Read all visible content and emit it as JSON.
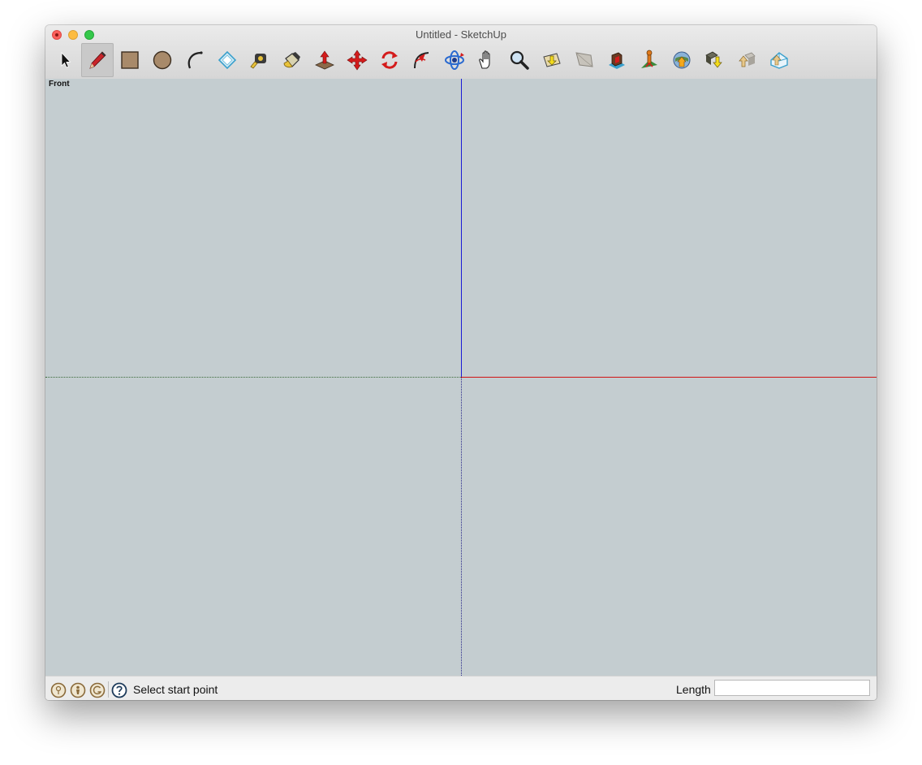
{
  "window": {
    "title": "Untitled - SketchUp",
    "controls": [
      "close",
      "minimize",
      "zoom"
    ]
  },
  "toolbar": {
    "active_tool": "line",
    "tools": [
      {
        "id": "select",
        "icon": "select-arrow-icon"
      },
      {
        "id": "line",
        "icon": "pencil-icon"
      },
      {
        "id": "rectangle",
        "icon": "rectangle-icon"
      },
      {
        "id": "circle",
        "icon": "circle-icon"
      },
      {
        "id": "arc",
        "icon": "arc-icon"
      },
      {
        "id": "eraser",
        "icon": "eraser-icon"
      },
      {
        "id": "tape-measure",
        "icon": "tape-measure-icon"
      },
      {
        "id": "paint-bucket",
        "icon": "paint-bucket-icon"
      },
      {
        "id": "push-pull",
        "icon": "push-pull-icon"
      },
      {
        "id": "move",
        "icon": "move-icon"
      },
      {
        "id": "rotate",
        "icon": "rotate-icon"
      },
      {
        "id": "follow-me",
        "icon": "follow-me-icon"
      },
      {
        "id": "orbit",
        "icon": "orbit-icon"
      },
      {
        "id": "pan",
        "icon": "pan-hand-icon"
      },
      {
        "id": "zoom",
        "icon": "magnifier-icon"
      },
      {
        "id": "zoom-extents",
        "icon": "zoom-extents-icon"
      },
      {
        "id": "previous-view",
        "icon": "previous-view-icon"
      },
      {
        "id": "3d-warehouse",
        "icon": "warehouse-icon"
      },
      {
        "id": "position-camera",
        "icon": "position-camera-icon"
      },
      {
        "id": "add-location",
        "icon": "add-location-icon"
      },
      {
        "id": "get-models",
        "icon": "get-models-icon"
      },
      {
        "id": "share-model",
        "icon": "share-model-icon"
      },
      {
        "id": "extension-warehouse",
        "icon": "extension-warehouse-icon"
      }
    ]
  },
  "viewport": {
    "scene_label": "Front",
    "background": "#c4cdd0",
    "axis_colors": {
      "red": "#d01414",
      "green": "#3a6a3a",
      "blue": "#1a1ad6"
    }
  },
  "statusbar": {
    "icons": [
      "geo-location-icon",
      "credits-icon",
      "account-icon",
      "help-icon"
    ],
    "message": "Select start point",
    "measure_label": "Length",
    "measure_value": ""
  }
}
